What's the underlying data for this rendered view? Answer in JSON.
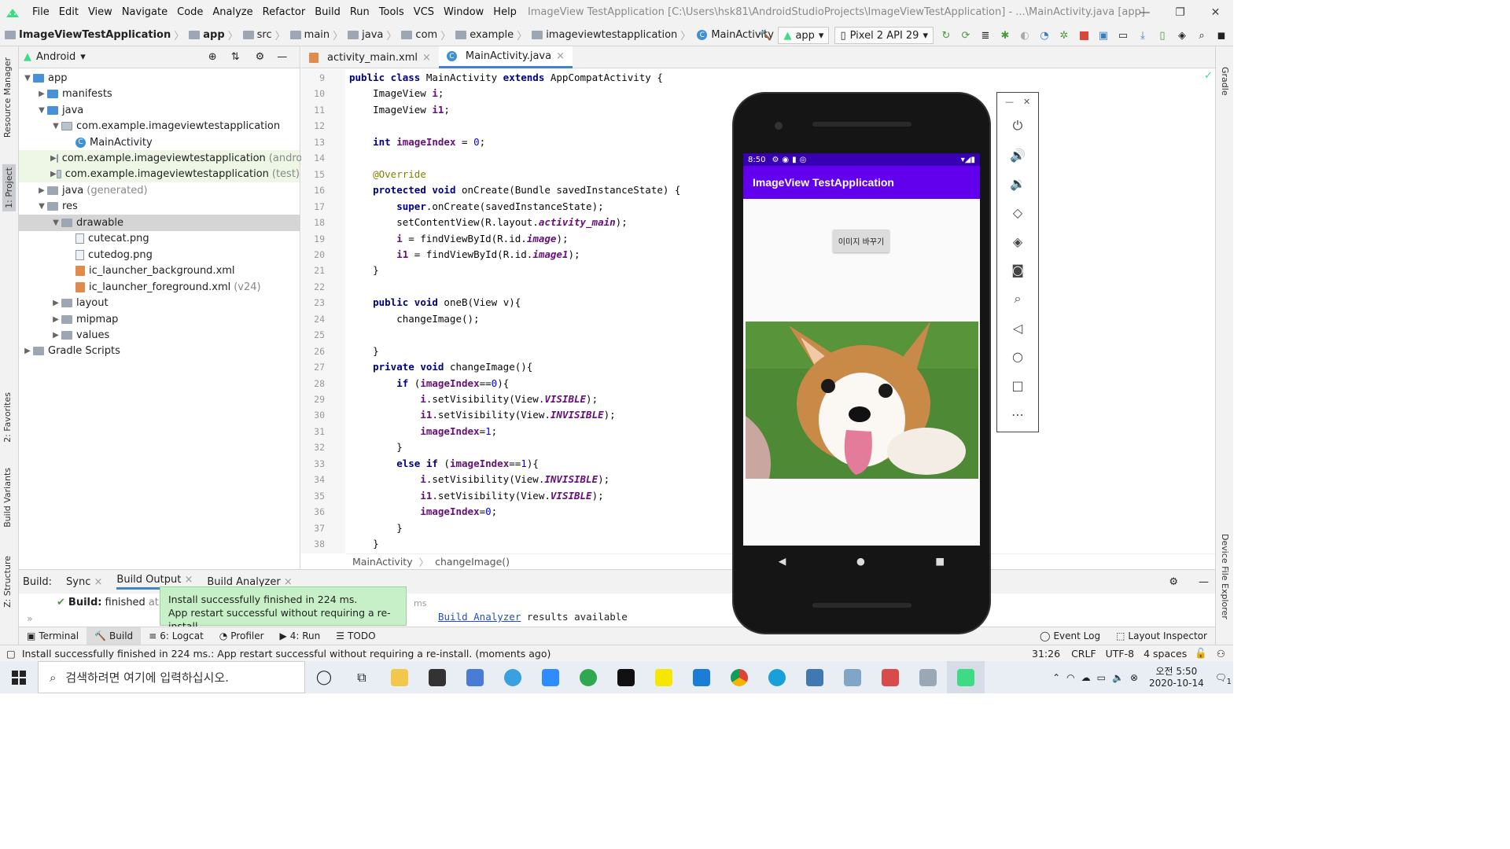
{
  "menu": {
    "items": [
      "File",
      "Edit",
      "View",
      "Navigate",
      "Code",
      "Analyze",
      "Refactor",
      "Build",
      "Run",
      "Tools",
      "VCS",
      "Window",
      "Help"
    ],
    "window_title": "ImageView TestApplication [C:\\Users\\hsk81\\AndroidStudioProjects\\ImageViewTestApplication] - ...\\MainActivity.java [app]"
  },
  "breadcrumb": [
    "ImageViewTestApplication",
    "app",
    "src",
    "main",
    "java",
    "com",
    "example",
    "imageviewtestapplication",
    "MainActivity"
  ],
  "toolbar": {
    "run_config": "app",
    "device": "Pixel 2 API 29"
  },
  "left_strip": {
    "resource_manager": "Resource Manager",
    "project": "1: Project",
    "favorites": "2: Favorites",
    "build_variants": "Build Variants",
    "structure": "Z: Structure"
  },
  "right_strip": {
    "gradle": "Gradle",
    "device_file_explorer": "Device File Explorer"
  },
  "project": {
    "view": "Android",
    "tree": [
      {
        "label": "app",
        "suffix": "",
        "depth": 0,
        "arrow": "▼",
        "icon": "folder-blue"
      },
      {
        "label": "manifests",
        "suffix": "",
        "depth": 1,
        "arrow": "▶",
        "icon": "folder-blue"
      },
      {
        "label": "java",
        "suffix": "",
        "depth": 1,
        "arrow": "▼",
        "icon": "folder-blue"
      },
      {
        "label": "com.example.imageviewtestapplication",
        "suffix": "",
        "depth": 2,
        "arrow": "▼",
        "icon": "package"
      },
      {
        "label": "MainActivity",
        "suffix": "",
        "depth": 3,
        "arrow": "",
        "icon": "class"
      },
      {
        "label": "com.example.imageviewtestapplication",
        "suffix": "(androidTest)",
        "depth": 2,
        "arrow": "▶",
        "icon": "package"
      },
      {
        "label": "com.example.imageviewtestapplication",
        "suffix": "(test)",
        "depth": 2,
        "arrow": "▶",
        "icon": "package"
      },
      {
        "label": "java",
        "suffix": "(generated)",
        "depth": 1,
        "arrow": "▶",
        "icon": "folder"
      },
      {
        "label": "res",
        "suffix": "",
        "depth": 1,
        "arrow": "▼",
        "icon": "folder"
      },
      {
        "label": "drawable",
        "suffix": "",
        "depth": 2,
        "arrow": "▼",
        "icon": "folder"
      },
      {
        "label": "cutecat.png",
        "suffix": "",
        "depth": 3,
        "arrow": "",
        "icon": "file"
      },
      {
        "label": "cutedog.png",
        "suffix": "",
        "depth": 3,
        "arrow": "",
        "icon": "file"
      },
      {
        "label": "ic_launcher_background.xml",
        "suffix": "",
        "depth": 3,
        "arrow": "",
        "icon": "xml"
      },
      {
        "label": "ic_launcher_foreground.xml",
        "suffix": "(v24)",
        "depth": 3,
        "arrow": "",
        "icon": "xml"
      },
      {
        "label": "layout",
        "suffix": "",
        "depth": 2,
        "arrow": "▶",
        "icon": "folder"
      },
      {
        "label": "mipmap",
        "suffix": "",
        "depth": 2,
        "arrow": "▶",
        "icon": "folder"
      },
      {
        "label": "values",
        "suffix": "",
        "depth": 2,
        "arrow": "▶",
        "icon": "folder"
      },
      {
        "label": "Gradle Scripts",
        "suffix": "",
        "depth": 0,
        "arrow": "▶",
        "icon": "gradle"
      }
    ]
  },
  "editor": {
    "tabs": [
      "activity_main.xml",
      "MainActivity.java"
    ],
    "first_line": 9,
    "lines": [
      "<kw>public class</kw> MainActivity <kw>extends</kw> AppCompatActivity {",
      "    ImageView <fld>i</fld>;",
      "    ImageView <fld>i1</fld>;",
      "",
      "    <kw>int</kw> <fld>imageIndex</fld> = <num>0</num>;",
      "",
      "    <an>@Override</an>",
      "    <kw>protected void</kw> onCreate(Bundle savedInstanceState) {",
      "        <kw>super</kw>.onCreate(savedInstanceState);",
      "        setContentView(R.layout.<it>activity_main</it>);",
      "        <fld>i</fld> = findViewById(R.id.<it>image</it>);",
      "        <fld>i1</fld> = findViewById(R.id.<it>image1</it>);",
      "    }",
      "",
      "    <kw>public void</kw> oneB(View v){",
      "        changeImage();",
      "",
      "    }",
      "    <kw>private void</kw> changeImage(){",
      "        <kw>if</kw> (<fld>imageIndex</fld>==<num>0</num>){",
      "            <fld>i</fld>.setVisibility(View.<it>VISIBLE</it>);",
      "            <fld>i1</fld>.setVisibility(View.<it>INVISIBLE</it>);",
      "            <fld>imageIndex</fld>=<num>1</num>;",
      "        }",
      "        <kw>else if</kw> (<fld>imageIndex</fld>==<num>1</num>){",
      "            <fld>i</fld>.setVisibility(View.<it>INVISIBLE</it>);",
      "            <fld>i1</fld>.setVisibility(View.<it>VISIBLE</it>);",
      "            <fld>imageIndex</fld>=<num>0</num>;",
      "        }",
      "    }"
    ],
    "breadcrumb": [
      "MainActivity",
      "changeImage()"
    ]
  },
  "build": {
    "label": "Build:",
    "tabs": [
      "Sync",
      "Build Output",
      "Build Analyzer"
    ],
    "result_prefix": "Build:",
    "result_text": "finished",
    "result_time": "at 2",
    "ms": "ms",
    "analyzer_link": "Build Analyzer",
    "analyzer_text": "results available"
  },
  "toast": {
    "line1": "Install successfully finished in 224 ms.",
    "line2": "App restart successful without requiring a re-install."
  },
  "tool_windows": [
    "Terminal",
    "Build",
    "6: Logcat",
    "Profiler",
    "4: Run",
    "TODO"
  ],
  "tool_windows_right": [
    "Event Log",
    "Layout Inspector"
  ],
  "status": {
    "message": "Install successfully finished in 224 ms.: App restart successful without requiring a re-install. (moments ago)",
    "position": "31:26",
    "line_sep": "CRLF",
    "encoding": "UTF-8",
    "indent": "4 spaces"
  },
  "emulator": {
    "time": "8:50",
    "app_title": "ImageView TestApplication",
    "button_label": "이미지 바꾸기"
  },
  "taskbar": {
    "search_placeholder": "검색하려면 여기에 입력하십시오.",
    "clock_time": "오전 5:50",
    "clock_date": "2020-10-14",
    "notif_count": "1"
  },
  "colors": {
    "accent": "#6200ee",
    "status_bar": "#3700b3",
    "toast_bg": "#c8f0c8",
    "current_line": "#fffae3"
  }
}
